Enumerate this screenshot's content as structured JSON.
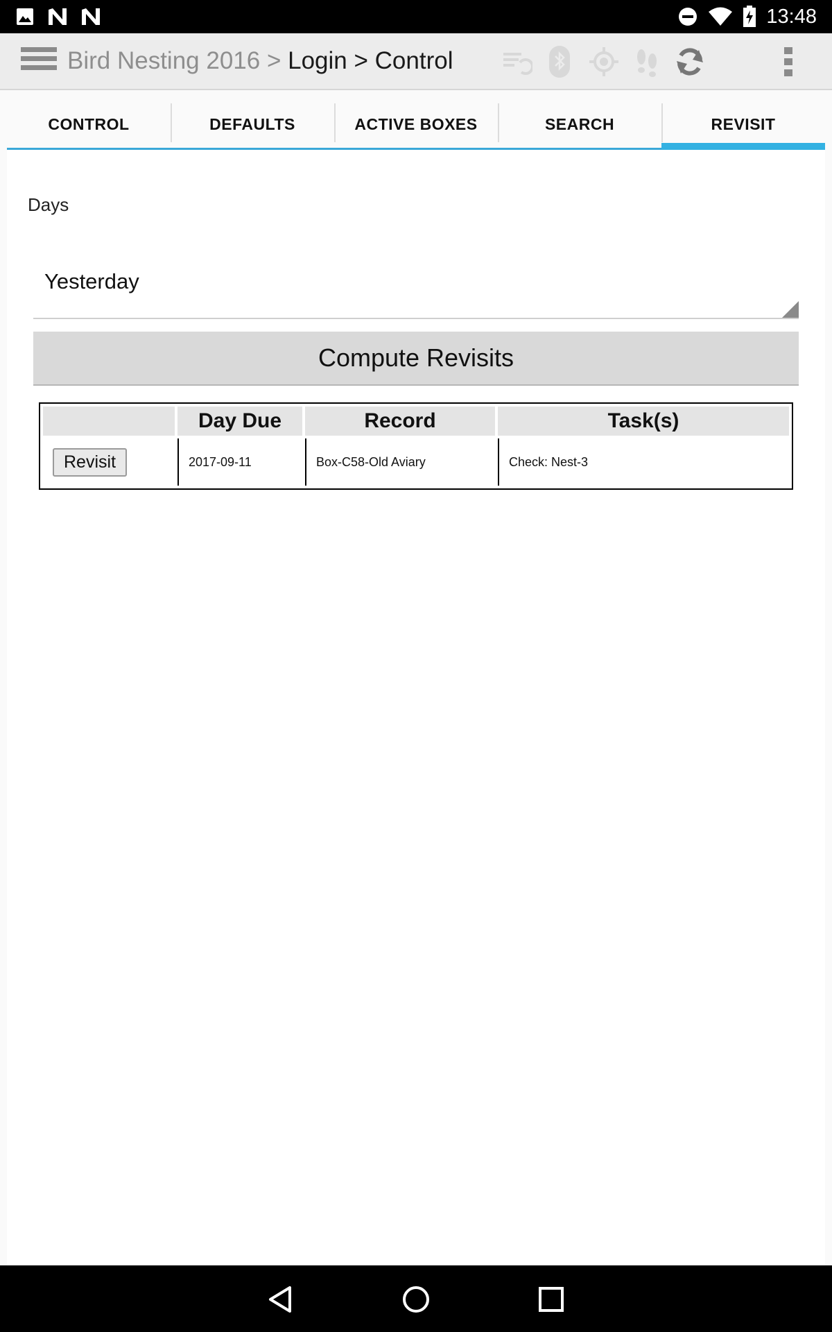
{
  "status_bar": {
    "time": "13:48",
    "left_icons": [
      "image-icon",
      "n-notification-icon",
      "n-notification-icon"
    ],
    "right_icons": [
      "do-not-disturb-icon",
      "wifi-icon",
      "battery-charging-icon"
    ]
  },
  "action_bar": {
    "breadcrumb_app": "Bird Nesting 2016 >",
    "breadcrumb_rest": "Login > Control",
    "icons": [
      "menu-icon",
      "sync-list-icon",
      "bluetooth-icon",
      "gps-icon",
      "footsteps-icon",
      "refresh-icon",
      "overflow-menu-icon"
    ]
  },
  "tabs": [
    {
      "label": "CONTROL",
      "active": false
    },
    {
      "label": "DEFAULTS",
      "active": false
    },
    {
      "label": "ACTIVE BOXES",
      "active": false
    },
    {
      "label": "SEARCH",
      "active": false
    },
    {
      "label": "REVISIT",
      "active": true
    }
  ],
  "form": {
    "days_label": "Days",
    "days_value": "Yesterday",
    "compute_label": "Compute Revisits"
  },
  "table": {
    "headers": [
      "",
      "Day Due",
      "Record",
      "Task(s)"
    ],
    "rows": [
      {
        "action": "Revisit",
        "day_due": "2017-09-11",
        "record": "Box-C58-Old Aviary",
        "tasks": "Check: Nest-3"
      }
    ]
  },
  "nav_bar": {
    "buttons": [
      "back-icon",
      "home-icon",
      "recents-icon"
    ]
  },
  "colors": {
    "accent": "#33b1e2",
    "action_bar_bg": "#ececec",
    "button_bg": "#d9d9d9"
  }
}
